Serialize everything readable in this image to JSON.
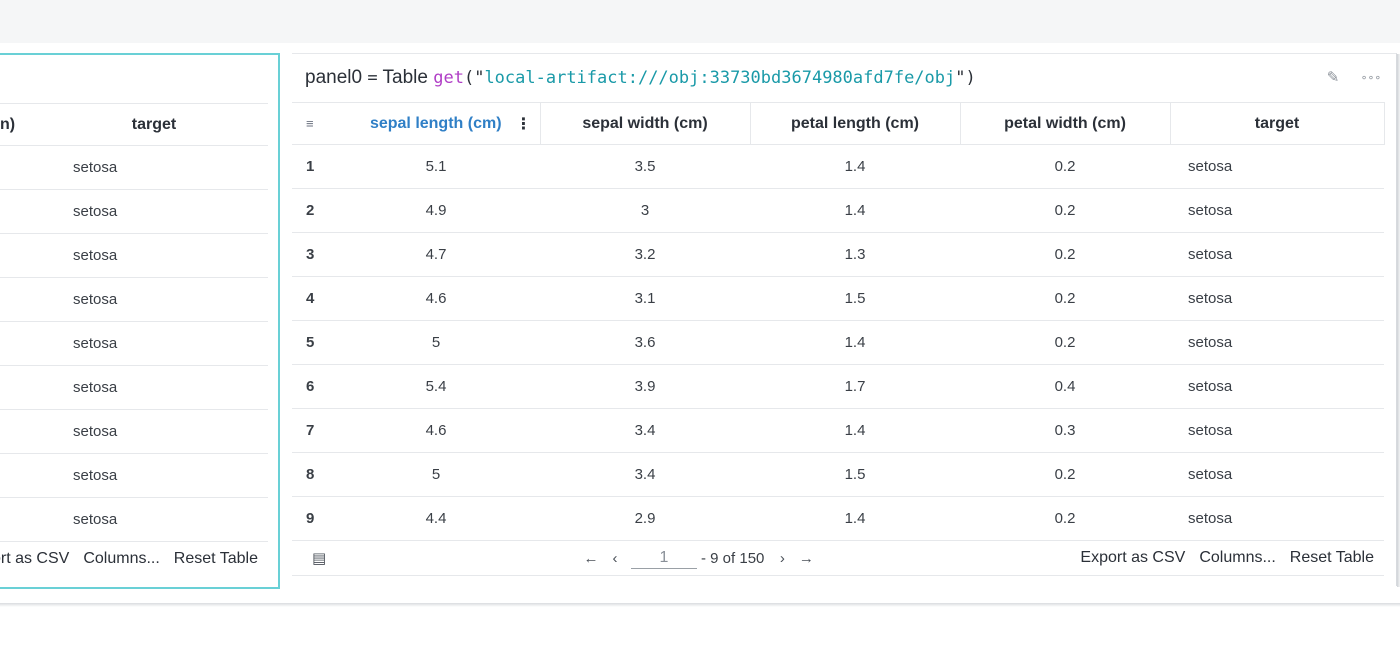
{
  "left_panel": {
    "headers": [
      "n)",
      "target"
    ],
    "rows": [
      "setosa",
      "setosa",
      "setosa",
      "setosa",
      "setosa",
      "setosa",
      "setosa",
      "setosa",
      "setosa"
    ],
    "footer": {
      "export": "ort as CSV",
      "columns": "Columns...",
      "reset": "Reset Table"
    }
  },
  "panel": {
    "var_name": "panel0",
    "eq": "=",
    "type": "Table",
    "fn": "get",
    "open": "(\"",
    "uri": "local-artifact:///obj:33730bd3674980afd7fe/obj",
    "close": "\")",
    "icons": [
      "pencil-icon",
      "more-icon"
    ],
    "icon_glyphs": {
      "edit": "✎",
      "more": "∘∘∘"
    }
  },
  "table": {
    "sort_glyph": "≡",
    "menu_glyph": "⋮",
    "headers": [
      "sepal length (cm)",
      "sepal width (cm)",
      "petal length (cm)",
      "petal width (cm)",
      "target"
    ],
    "rows": [
      {
        "i": "1",
        "sl": "5.1",
        "sw": "3.5",
        "pl": "1.4",
        "pw": "0.2",
        "t": "setosa"
      },
      {
        "i": "2",
        "sl": "4.9",
        "sw": "3",
        "pl": "1.4",
        "pw": "0.2",
        "t": "setosa"
      },
      {
        "i": "3",
        "sl": "4.7",
        "sw": "3.2",
        "pl": "1.3",
        "pw": "0.2",
        "t": "setosa"
      },
      {
        "i": "4",
        "sl": "4.6",
        "sw": "3.1",
        "pl": "1.5",
        "pw": "0.2",
        "t": "setosa"
      },
      {
        "i": "5",
        "sl": "5",
        "sw": "3.6",
        "pl": "1.4",
        "pw": "0.2",
        "t": "setosa"
      },
      {
        "i": "6",
        "sl": "5.4",
        "sw": "3.9",
        "pl": "1.7",
        "pw": "0.4",
        "t": "setosa"
      },
      {
        "i": "7",
        "sl": "4.6",
        "sw": "3.4",
        "pl": "1.4",
        "pw": "0.3",
        "t": "setosa"
      },
      {
        "i": "8",
        "sl": "5",
        "sw": "3.4",
        "pl": "1.5",
        "pw": "0.2",
        "t": "setosa"
      },
      {
        "i": "9",
        "sl": "4.4",
        "sw": "2.9",
        "pl": "1.4",
        "pw": "0.2",
        "t": "setosa"
      }
    ]
  },
  "pagination": {
    "first": "←",
    "prev": "‹",
    "page": "1",
    "range": "- 9 of 150",
    "next": "›",
    "last": "→",
    "table_icon": "▤"
  },
  "footer_actions": {
    "export": "Export as CSV",
    "columns": "Columns...",
    "reset": "Reset Table"
  },
  "colors": {
    "accent": "#2f7fc6",
    "selection": "#69d0d6",
    "function": "#b03ec6",
    "string": "#1a9aa8"
  }
}
